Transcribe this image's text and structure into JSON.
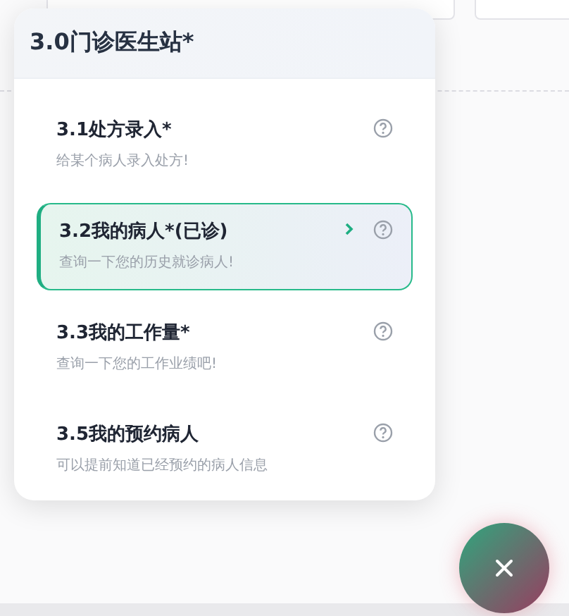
{
  "menu": {
    "title": "3.0门诊医生站*",
    "items": [
      {
        "title": "3.1处方录入*",
        "description": "给某个病人录入处方!",
        "selected": false
      },
      {
        "title": "3.2我的病人*(已诊)",
        "description": "查询一下您的历史就诊病人!",
        "selected": true
      },
      {
        "title": "3.3我的工作量*",
        "description": "查询一下您的工作业绩吧!",
        "selected": false
      },
      {
        "title": "3.5我的预约病人",
        "description": "可以提前知道已经预约的病人信息",
        "selected": false
      }
    ]
  }
}
